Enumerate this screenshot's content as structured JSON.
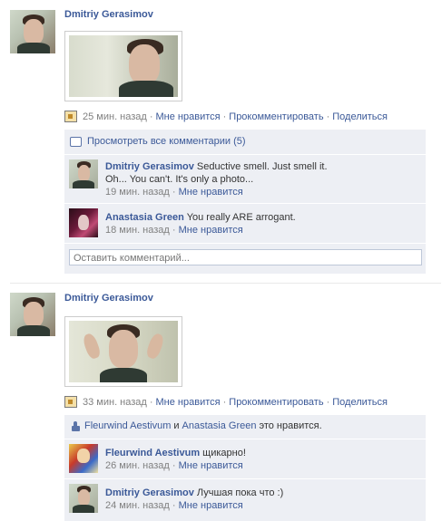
{
  "posts": [
    {
      "author": "Dmitriy Gerasimov",
      "time": "25 мин. назад",
      "like": "Мне нравится",
      "comment": "Прокомментировать",
      "share": "Поделиться",
      "view_all": "Просмотреть все комментарии (5)",
      "comments": [
        {
          "author": "Dmitriy Gerasimov",
          "text": "Seductive smell. Just smell it.",
          "text2": "Oh... You can't. It's only a photo...",
          "time": "19 мин. назад",
          "like": "Мне нравится"
        },
        {
          "author": "Anastasia Green",
          "text": "You really ARE arrogant.",
          "time": "18 мин. назад",
          "like": "Мне нравится"
        }
      ],
      "input_placeholder": "Оставить комментарий..."
    },
    {
      "author": "Dmitriy Gerasimov",
      "time": "33 мин. назад",
      "like": "Мне нравится",
      "comment": "Прокомментировать",
      "share": "Поделиться",
      "likes_line": {
        "user1": "Fleurwind Aestivum",
        "and": "и",
        "user2": "Anastasia Green",
        "suffix": "это нравится."
      },
      "comments": [
        {
          "author": "Fleurwind Aestivum",
          "text": "щикарно!",
          "time": "26 мин. назад",
          "like": "Мне нравится"
        },
        {
          "author": "Dmitriy Gerasimov",
          "text": "Лучшая пока что :)",
          "time": "24 мин. назад",
          "like": "Мне нравится"
        }
      ]
    }
  ],
  "separator": "·",
  "colors": {
    "link": "#3b5998",
    "meta": "#808080",
    "ufi_bg": "#edeff4"
  }
}
